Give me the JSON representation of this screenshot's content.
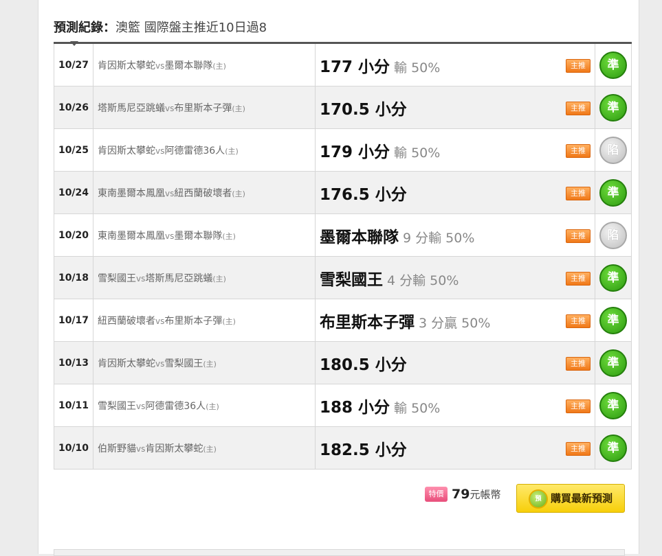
{
  "heading": {
    "label": "預測紀錄",
    "colon": "：",
    "desc": "澳籃 國際盤主推近10日過8"
  },
  "rows": [
    {
      "date": "10/27",
      "team1": "肯因斯太攀蛇",
      "vs": "vs",
      "team2": "墨爾本聯隊",
      "home": "(主)",
      "pick": "177 小分",
      "detail": "輸 50%",
      "badge": "主推",
      "result": "準",
      "status": "hit"
    },
    {
      "date": "10/26",
      "team1": "塔斯馬尼亞跳蟻",
      "vs": "vs",
      "team2": "布里斯本子彈",
      "home": "(主)",
      "pick": "170.5 小分",
      "detail": "",
      "badge": "主推",
      "result": "準",
      "status": "hit"
    },
    {
      "date": "10/25",
      "team1": "肯因斯太攀蛇",
      "vs": "vs",
      "team2": "阿德雷德36人",
      "home": "(主)",
      "pick": "179 小分",
      "detail": "輸 50%",
      "badge": "主推",
      "result": "陷",
      "status": "miss"
    },
    {
      "date": "10/24",
      "team1": "東南墨爾本鳳凰",
      "vs": "vs",
      "team2": "紐西蘭破壞者",
      "home": "(主)",
      "pick": "176.5 小分",
      "detail": "",
      "badge": "主推",
      "result": "準",
      "status": "hit"
    },
    {
      "date": "10/20",
      "team1": "東南墨爾本鳳凰",
      "vs": "vs",
      "team2": "墨爾本聯隊",
      "home": "(主)",
      "pick": "墨爾本聯隊",
      "detail": "9 分輸 50%",
      "badge": "主推",
      "result": "陷",
      "status": "miss"
    },
    {
      "date": "10/18",
      "team1": "雪梨國王",
      "vs": "vs",
      "team2": "塔斯馬尼亞跳蟻",
      "home": "(主)",
      "pick": "雪梨國王",
      "detail": "4 分輸 50%",
      "badge": "主推",
      "result": "準",
      "status": "hit"
    },
    {
      "date": "10/17",
      "team1": "紐西蘭破壞者",
      "vs": "vs",
      "team2": "布里斯本子彈",
      "home": "(主)",
      "pick": "布里斯本子彈",
      "detail": "3 分贏 50%",
      "badge": "主推",
      "result": "準",
      "status": "hit"
    },
    {
      "date": "10/13",
      "team1": "肯因斯太攀蛇",
      "vs": "vs",
      "team2": "雪梨國王",
      "home": "(主)",
      "pick": "180.5 小分",
      "detail": "",
      "badge": "主推",
      "result": "準",
      "status": "hit"
    },
    {
      "date": "10/11",
      "team1": "雪梨國王",
      "vs": "vs",
      "team2": "阿德雷德36人",
      "home": "(主)",
      "pick": "188 小分",
      "detail": "輸 50%",
      "badge": "主推",
      "result": "準",
      "status": "hit"
    },
    {
      "date": "10/10",
      "team1": "伯斯野貓",
      "vs": "vs",
      "team2": "肯因斯太攀蛇",
      "home": "(主)",
      "pick": "182.5 小分",
      "detail": "",
      "badge": "主推",
      "result": "準",
      "status": "hit"
    }
  ],
  "purchase": {
    "tag": "特價",
    "amount": "79",
    "unit": "元帳幣",
    "button_icon_text": "預",
    "button_label": "購買最新預測"
  }
}
